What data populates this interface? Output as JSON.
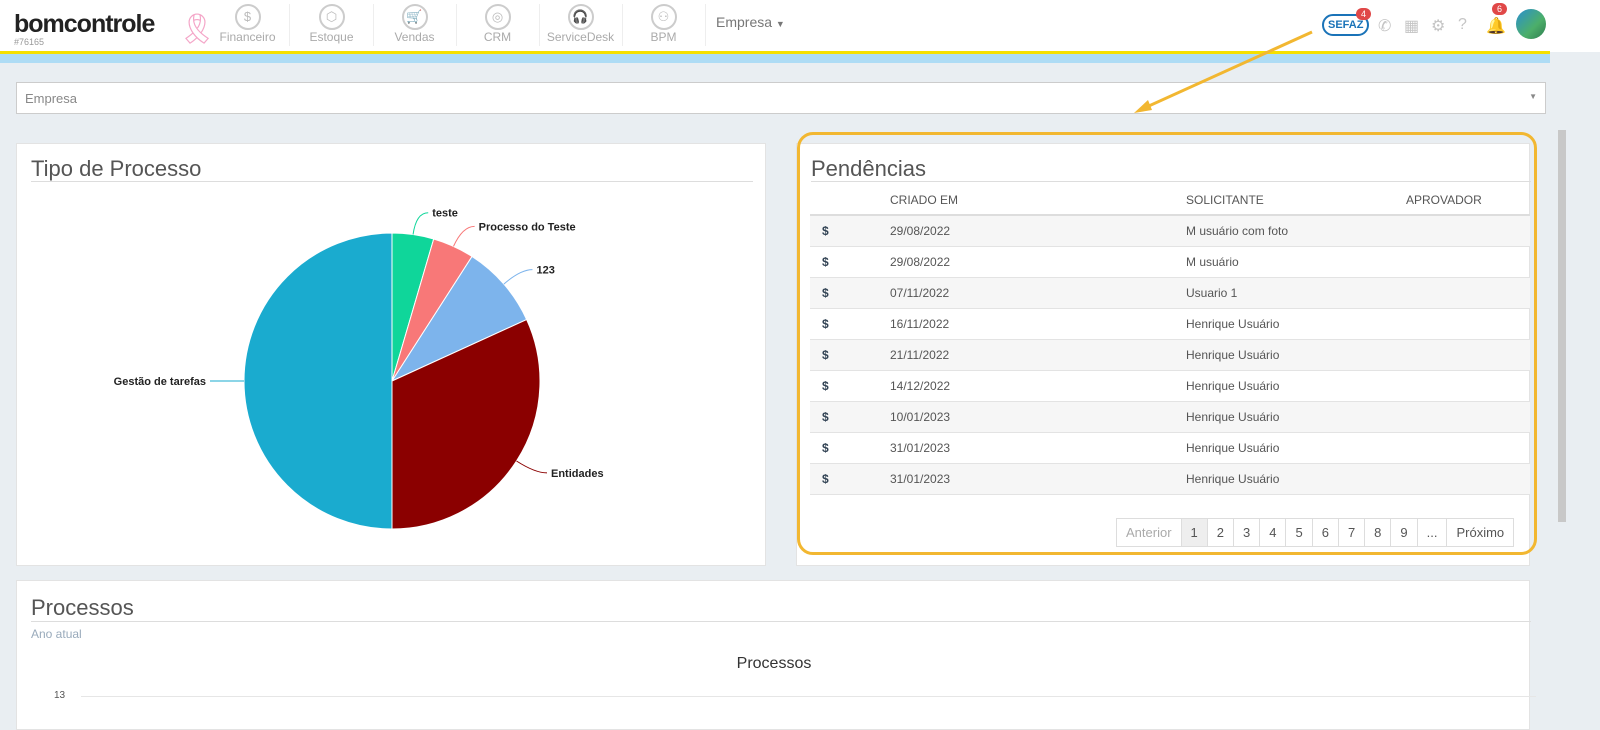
{
  "header": {
    "logo": "bomcontrole",
    "account": "#76165",
    "modules": [
      "Financeiro",
      "Estoque",
      "Vendas",
      "CRM",
      "ServiceDesk",
      "BPM"
    ],
    "company_menu": "Empresa",
    "sefaz": "SEFAZ",
    "sefaz_badge": "4",
    "notif_badge": "6"
  },
  "filter": {
    "placeholder": "Empresa"
  },
  "pie": {
    "title": "Tipo de Processo",
    "chart_data": {
      "type": "pie",
      "title": "Tipo de Processo",
      "labels": [
        "teste",
        "Processo do Teste",
        "123",
        "Entidades",
        "Gestão de tarefas"
      ],
      "values": [
        1,
        1,
        2,
        7,
        11
      ],
      "colors": [
        "#0fd69a",
        "#f87878",
        "#7db4ec",
        "#8b0000",
        "#1aabcf"
      ]
    }
  },
  "pend": {
    "title": "Pendências",
    "columns": [
      "",
      "CRIADO EM",
      "SOLICITANTE",
      "APROVADOR"
    ],
    "rows": [
      [
        "$",
        "29/08/2022",
        "M usuário com foto",
        ""
      ],
      [
        "$",
        "29/08/2022",
        "M usuário",
        ""
      ],
      [
        "$",
        "07/11/2022",
        "Usuario 1",
        ""
      ],
      [
        "$",
        "16/11/2022",
        "Henrique Usuário",
        ""
      ],
      [
        "$",
        "21/11/2022",
        "Henrique Usuário",
        ""
      ],
      [
        "$",
        "14/12/2022",
        "Henrique Usuário",
        ""
      ],
      [
        "$",
        "10/01/2023",
        "Henrique Usuário",
        ""
      ],
      [
        "$",
        "31/01/2023",
        "Henrique Usuário",
        ""
      ],
      [
        "$",
        "31/01/2023",
        "Henrique Usuário",
        ""
      ]
    ],
    "pagination": [
      "Anterior",
      "1",
      "2",
      "3",
      "4",
      "5",
      "6",
      "7",
      "8",
      "9",
      "...",
      "Próximo"
    ]
  },
  "proc": {
    "title": "Processos",
    "subtitle": "Ano atual",
    "chart_title": "Processos",
    "ytick": "13"
  }
}
